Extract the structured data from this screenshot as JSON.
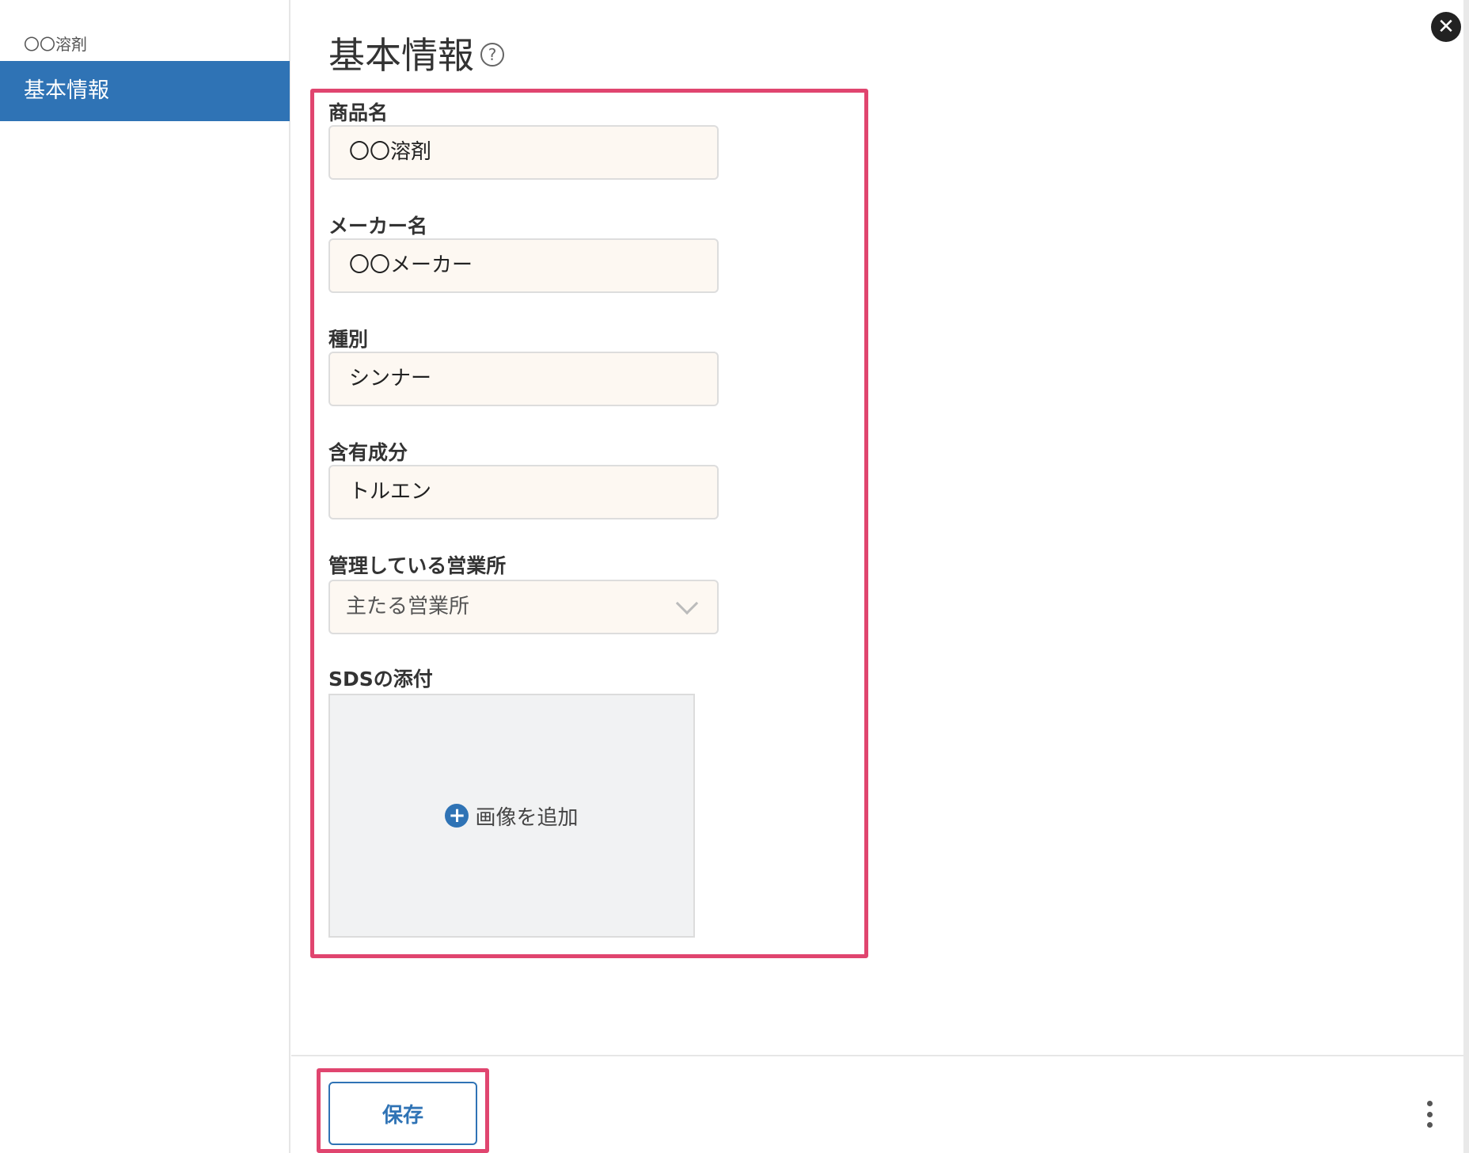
{
  "sidebar": {
    "subtitle": "〇〇溶剤",
    "items": [
      {
        "label": "基本情報"
      }
    ]
  },
  "header": {
    "title": "基本情報",
    "help_glyph": "?"
  },
  "form": {
    "fields": [
      {
        "label": "商品名",
        "value": "〇〇溶剤"
      },
      {
        "label": "メーカー名",
        "value": "〇〇メーカー"
      },
      {
        "label": "種別",
        "value": "シンナー"
      },
      {
        "label": "含有成分",
        "value": "トルエン"
      }
    ],
    "office": {
      "label": "管理している営業所",
      "selected": "主たる営業所"
    },
    "sds": {
      "label": "SDSの添付",
      "add_label": "画像を追加"
    }
  },
  "footer": {
    "save_label": "保存"
  },
  "icons": {
    "close": "close-icon",
    "help": "help-circle-icon",
    "add": "plus-circle-icon",
    "more": "more-vertical-icon",
    "chevron": "chevron-down-icon"
  },
  "colors": {
    "accent": "#2f73b5",
    "highlight": "#e0456f",
    "input_bg": "#fdf8f2"
  }
}
